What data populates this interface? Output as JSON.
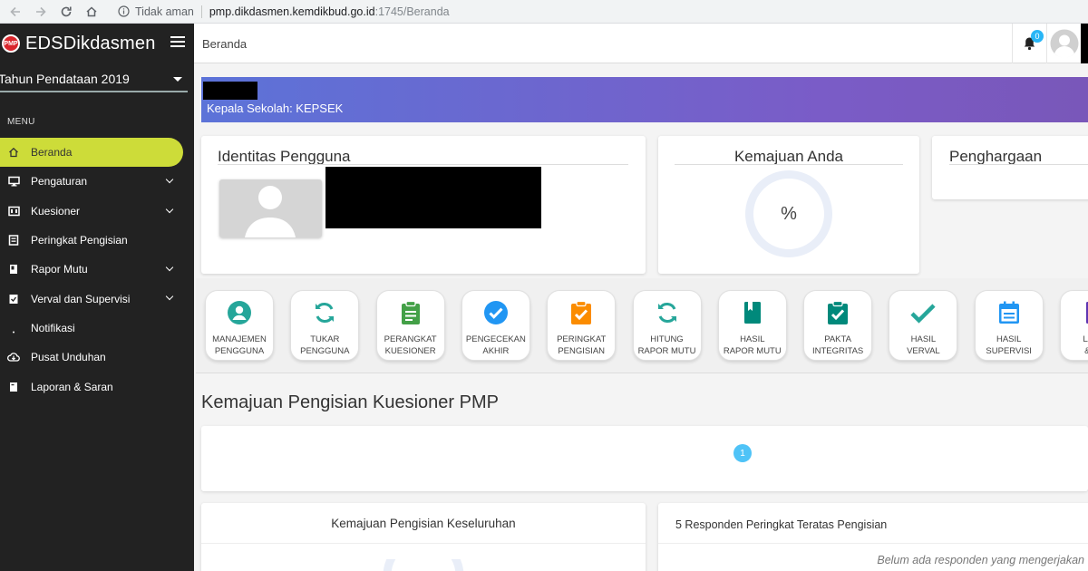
{
  "browser": {
    "security_text": "Tidak aman",
    "url_host": "pmp.dikdasmen.kemdikbud.go.id",
    "url_rest": ":1745/Beranda"
  },
  "sidebar": {
    "brand_logo_text": "PMP",
    "brand_name": "EDSDikdasmen",
    "year_select": "Tahun Pendataan 2019",
    "menu_heading": "MENU",
    "items": [
      {
        "label": "Beranda",
        "icon": "home-icon",
        "active": true,
        "has_children": false
      },
      {
        "label": "Pengaturan",
        "icon": "monitor-icon",
        "active": false,
        "has_children": true
      },
      {
        "label": "Kuesioner",
        "icon": "questionnaire-icon",
        "active": false,
        "has_children": true
      },
      {
        "label": "Peringkat Pengisian",
        "icon": "ranking-icon",
        "active": false,
        "has_children": false
      },
      {
        "label": "Rapor Mutu",
        "icon": "book-icon",
        "active": false,
        "has_children": true
      },
      {
        "label": "Verval dan Supervisi",
        "icon": "verify-icon",
        "active": false,
        "has_children": true
      },
      {
        "label": "Notifikasi",
        "icon": "bell-icon",
        "active": false,
        "has_children": false
      },
      {
        "label": "Pusat Unduhan",
        "icon": "cloud-download-icon",
        "active": false,
        "has_children": false
      },
      {
        "label": "Laporan & Saran",
        "icon": "report-icon",
        "active": false,
        "has_children": false
      }
    ]
  },
  "topbar": {
    "breadcrumb": "Beranda",
    "notification_count": "0"
  },
  "banner": {
    "role_text": "Kepala Sekolah: KEPSEK"
  },
  "cards": {
    "identity_title": "Identitas Pengguna",
    "progress_title": "Kemajuan Anda",
    "progress_value": "%",
    "awards_title": "Penghargaan"
  },
  "shortcuts": [
    {
      "label": "Manajemen Pengguna",
      "line1": "MANAJEMEN",
      "line2": "PENGGUNA",
      "icon": "user-circle-icon",
      "color": "#26a69a"
    },
    {
      "label": "Tukar Pengguna",
      "line1": "TUKAR",
      "line2": "PENGGUNA",
      "icon": "sync-icon",
      "color": "#26a69a"
    },
    {
      "label": "Perangkat Kuesioner",
      "line1": "PERANGKAT",
      "line2": "KUESIONER",
      "icon": "clipboard-list-icon",
      "color": "#43a047"
    },
    {
      "label": "Pengecekan Akhir",
      "line1": "PENGECEKAN",
      "line2": "AKHIR",
      "icon": "check-circle-icon",
      "color": "#2196f3"
    },
    {
      "label": "Peringkat Pengisian",
      "line1": "PERINGKAT",
      "line2": "PENGISIAN",
      "icon": "clipboard-check-icon",
      "color": "#fb8c00"
    },
    {
      "label": "Hitung Rapor Mutu",
      "line1": "HITUNG",
      "line2": "RAPOR MUTU",
      "icon": "sync-icon",
      "color": "#26a69a"
    },
    {
      "label": "Hasil Rapor Mutu",
      "line1": "HASIL",
      "line2": "RAPOR MUTU",
      "icon": "book-icon",
      "color": "#00897b"
    },
    {
      "label": "Pakta Integritas",
      "line1": "PAKTA",
      "line2": "INTEGRITAS",
      "icon": "clipboard-check-icon",
      "color": "#00897b"
    },
    {
      "label": "Hasil Verval",
      "line1": "HASIL",
      "line2": "VERVAL",
      "icon": "checkmark-icon",
      "color": "#26a69a"
    },
    {
      "label": "Hasil Supervisi",
      "line1": "HASIL",
      "line2": "SUPERVISI",
      "icon": "calendar-icon",
      "color": "#2196f3"
    },
    {
      "label": "Laporan & Saran",
      "line1": "LAPO",
      "line2": "& SA",
      "icon": "report-icon",
      "color": "#5e35b1"
    }
  ],
  "main": {
    "section_title": "Kemajuan Pengisian Kuesioner PMP",
    "step_number": "1",
    "overall_title": "Kemajuan Pengisian Keseluruhan",
    "top5_title": "5 Responden Peringkat Teratas Pengisian",
    "empty_note": "Belum ada responden yang mengerjakan"
  }
}
